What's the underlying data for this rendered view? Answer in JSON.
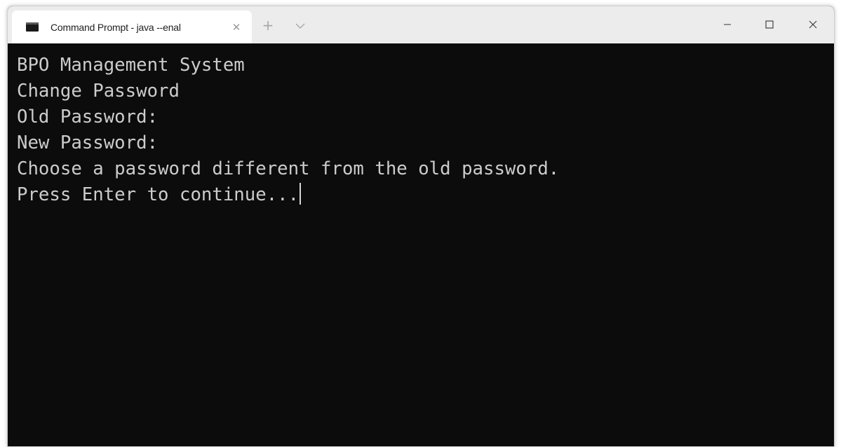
{
  "window": {
    "tab_title": "Command Prompt - java  --enal",
    "tab_icon": "terminal-icon",
    "tab_close_symbol": "✕",
    "new_tab_symbol": "+",
    "dropdown_icon": "chevron-down-icon",
    "caption_buttons": [
      "minimize-icon",
      "maximize-icon",
      "close-icon"
    ]
  },
  "terminal": {
    "lines": [
      "BPO Management System",
      "Change Password",
      "Old Password:",
      "New Password:",
      "Choose a password different from the old password.",
      "Press Enter to continue..."
    ]
  },
  "colors": {
    "terminal_bg": "#0c0c0c",
    "terminal_fg": "#cccccc",
    "titlebar_bg": "#ececec",
    "tab_bg": "#ffffff"
  }
}
